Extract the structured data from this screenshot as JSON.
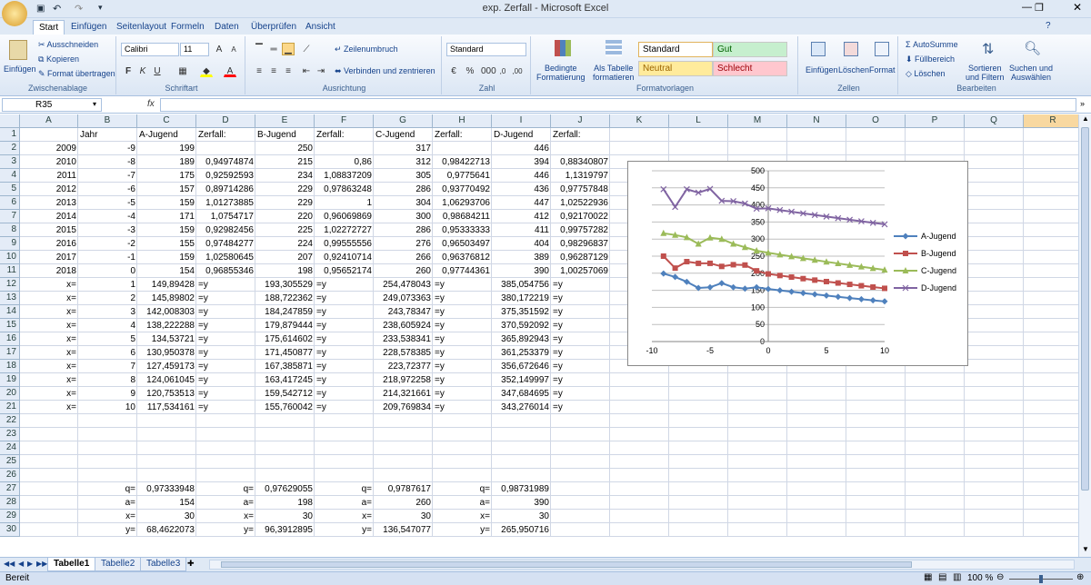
{
  "window": {
    "title": "exp. Zerfall - Microsoft Excel"
  },
  "ribbon_tabs": [
    "Start",
    "Einfügen",
    "Seitenlayout",
    "Formeln",
    "Daten",
    "Überprüfen",
    "Ansicht"
  ],
  "ribbon": {
    "clipboard": {
      "paste": "Einfügen",
      "cut": "Ausschneiden",
      "copy": "Kopieren",
      "format_painter": "Format übertragen",
      "label": "Zwischenablage"
    },
    "font": {
      "name": "Calibri",
      "size": "11",
      "label": "Schriftart"
    },
    "alignment": {
      "wrap": "Zeilenumbruch",
      "merge": "Verbinden und zentrieren",
      "label": "Ausrichtung"
    },
    "number": {
      "format": "Standard",
      "label": "Zahl"
    },
    "styles": {
      "cond": "Bedingte\nFormatierung",
      "table": "Als Tabelle\nformatieren",
      "standard": "Standard",
      "gut": "Gut",
      "neutral": "Neutral",
      "schlecht": "Schlecht",
      "label": "Formatvorlagen"
    },
    "cells": {
      "insert": "Einfügen",
      "delete": "Löschen",
      "format": "Format",
      "label": "Zellen"
    },
    "editing": {
      "autosum": "AutoSumme",
      "fill": "Füllbereich",
      "clear": "Löschen",
      "sort": "Sortieren\nund Filtern",
      "find": "Suchen und\nAuswählen",
      "label": "Bearbeiten"
    }
  },
  "formula_bar": {
    "name_box": "R35",
    "fx": "fx",
    "content": ""
  },
  "columns": [
    "A",
    "B",
    "C",
    "D",
    "E",
    "F",
    "G",
    "H",
    "I",
    "J",
    "K",
    "L",
    "M",
    "N",
    "O",
    "P",
    "Q",
    "R"
  ],
  "rows": [
    [
      "",
      "Jahr",
      "A-Jugend",
      "Zerfall:",
      "B-Jugend",
      "Zerfall:",
      "C-Jugend",
      "Zerfall:",
      "D-Jugend",
      "Zerfall:"
    ],
    [
      "2009",
      "-9",
      "199",
      "",
      "250",
      "",
      "317",
      "",
      "446",
      ""
    ],
    [
      "2010",
      "-8",
      "189",
      "0,94974874",
      "215",
      "0,86",
      "312",
      "0,98422713",
      "394",
      "0,88340807"
    ],
    [
      "2011",
      "-7",
      "175",
      "0,92592593",
      "234",
      "1,08837209",
      "305",
      "0,9775641",
      "446",
      "1,1319797"
    ],
    [
      "2012",
      "-6",
      "157",
      "0,89714286",
      "229",
      "0,97863248",
      "286",
      "0,93770492",
      "436",
      "0,97757848"
    ],
    [
      "2013",
      "-5",
      "159",
      "1,01273885",
      "229",
      "1",
      "304",
      "1,06293706",
      "447",
      "1,02522936"
    ],
    [
      "2014",
      "-4",
      "171",
      "1,0754717",
      "220",
      "0,96069869",
      "300",
      "0,98684211",
      "412",
      "0,92170022"
    ],
    [
      "2015",
      "-3",
      "159",
      "0,92982456",
      "225",
      "1,02272727",
      "286",
      "0,95333333",
      "411",
      "0,99757282"
    ],
    [
      "2016",
      "-2",
      "155",
      "0,97484277",
      "224",
      "0,99555556",
      "276",
      "0,96503497",
      "404",
      "0,98296837"
    ],
    [
      "2017",
      "-1",
      "159",
      "1,02580645",
      "207",
      "0,92410714",
      "266",
      "0,96376812",
      "389",
      "0,96287129"
    ],
    [
      "2018",
      "0",
      "154",
      "0,96855346",
      "198",
      "0,95652174",
      "260",
      "0,97744361",
      "390",
      "1,00257069"
    ],
    [
      "x=",
      "1",
      "149,89428",
      "=y",
      "193,305529",
      "=y",
      "254,478043",
      "=y",
      "385,054756",
      "=y"
    ],
    [
      "x=",
      "2",
      "145,89802",
      "=y",
      "188,722362",
      "=y",
      "249,073363",
      "=y",
      "380,172219",
      "=y"
    ],
    [
      "x=",
      "3",
      "142,008303",
      "=y",
      "184,247859",
      "=y",
      "243,78347",
      "=y",
      "375,351592",
      "=y"
    ],
    [
      "x=",
      "4",
      "138,222288",
      "=y",
      "179,879444",
      "=y",
      "238,605924",
      "=y",
      "370,592092",
      "=y"
    ],
    [
      "x=",
      "5",
      "134,53721",
      "=y",
      "175,614602",
      "=y",
      "233,538341",
      "=y",
      "365,892943",
      "=y"
    ],
    [
      "x=",
      "6",
      "130,950378",
      "=y",
      "171,450877",
      "=y",
      "228,578385",
      "=y",
      "361,253379",
      "=y"
    ],
    [
      "x=",
      "7",
      "127,459173",
      "=y",
      "167,385871",
      "=y",
      "223,72377",
      "=y",
      "356,672646",
      "=y"
    ],
    [
      "x=",
      "8",
      "124,061045",
      "=y",
      "163,417245",
      "=y",
      "218,972258",
      "=y",
      "352,149997",
      "=y"
    ],
    [
      "x=",
      "9",
      "120,753513",
      "=y",
      "159,542712",
      "=y",
      "214,321661",
      "=y",
      "347,684695",
      "=y"
    ],
    [
      "x=",
      "10",
      "117,534161",
      "=y",
      "155,760042",
      "=y",
      "209,769834",
      "=y",
      "343,276014",
      "=y"
    ],
    [
      "",
      "",
      "",
      "",
      "",
      "",
      "",
      "",
      "",
      ""
    ],
    [
      "",
      "",
      "",
      "",
      "",
      "",
      "",
      "",
      "",
      ""
    ],
    [
      "",
      "",
      "",
      "",
      "",
      "",
      "",
      "",
      "",
      ""
    ],
    [
      "",
      "",
      "",
      "",
      "",
      "",
      "",
      "",
      "",
      ""
    ],
    [
      "",
      "",
      "",
      "",
      "",
      "",
      "",
      "",
      "",
      ""
    ],
    [
      "",
      "q=",
      "0,97333948",
      "q=",
      "0,97629055",
      "q=",
      "0,9787617",
      "q=",
      "0,98731989",
      ""
    ],
    [
      "",
      "a=",
      "154",
      "a=",
      "198",
      "a=",
      "260",
      "a=",
      "390",
      ""
    ],
    [
      "",
      "x=",
      "30",
      "x=",
      "30",
      "x=",
      "30",
      "x=",
      "30",
      ""
    ],
    [
      "",
      "y=",
      "68,4622073",
      "y=",
      "96,3912895",
      "y=",
      "136,547077",
      "y=",
      "265,950716",
      ""
    ]
  ],
  "sheet_tabs": [
    "Tabelle1",
    "Tabelle2",
    "Tabelle3"
  ],
  "status": {
    "ready": "Bereit",
    "zoom": "100 %"
  },
  "chart_data": {
    "type": "line",
    "x": [
      -9,
      -8,
      -7,
      -6,
      -5,
      -4,
      -3,
      -2,
      -1,
      0,
      1,
      2,
      3,
      4,
      5,
      6,
      7,
      8,
      9,
      10
    ],
    "xlim": [
      -10,
      10
    ],
    "ylim": [
      0,
      500
    ],
    "xticks": [
      -10,
      -5,
      0,
      5,
      10
    ],
    "yticks": [
      0,
      50,
      100,
      150,
      200,
      250,
      300,
      350,
      400,
      450,
      500
    ],
    "legend_position": "right",
    "series": [
      {
        "name": "A-Jugend",
        "color": "#4f81bd",
        "marker": "diamond",
        "values": [
          199,
          189,
          175,
          157,
          159,
          171,
          159,
          155,
          159,
          154,
          149.89,
          145.9,
          142.01,
          138.22,
          134.54,
          130.95,
          127.46,
          124.06,
          120.75,
          117.53
        ]
      },
      {
        "name": "B-Jugend",
        "color": "#c0504d",
        "marker": "square",
        "values": [
          250,
          215,
          234,
          229,
          229,
          220,
          225,
          224,
          207,
          198,
          193.31,
          188.72,
          184.25,
          179.88,
          175.61,
          171.45,
          167.39,
          163.42,
          159.54,
          155.76
        ]
      },
      {
        "name": "C-Jugend",
        "color": "#9bbb59",
        "marker": "triangle",
        "values": [
          317,
          312,
          305,
          286,
          304,
          300,
          286,
          276,
          266,
          260,
          254.48,
          249.07,
          243.78,
          238.61,
          233.54,
          228.58,
          223.72,
          218.97,
          214.32,
          209.77
        ]
      },
      {
        "name": "D-Jugend",
        "color": "#8064a2",
        "marker": "x",
        "values": [
          446,
          394,
          446,
          436,
          447,
          412,
          411,
          404,
          389,
          390,
          385.05,
          380.17,
          375.35,
          370.59,
          365.89,
          361.25,
          356.67,
          352.15,
          347.68,
          343.28
        ]
      }
    ]
  }
}
